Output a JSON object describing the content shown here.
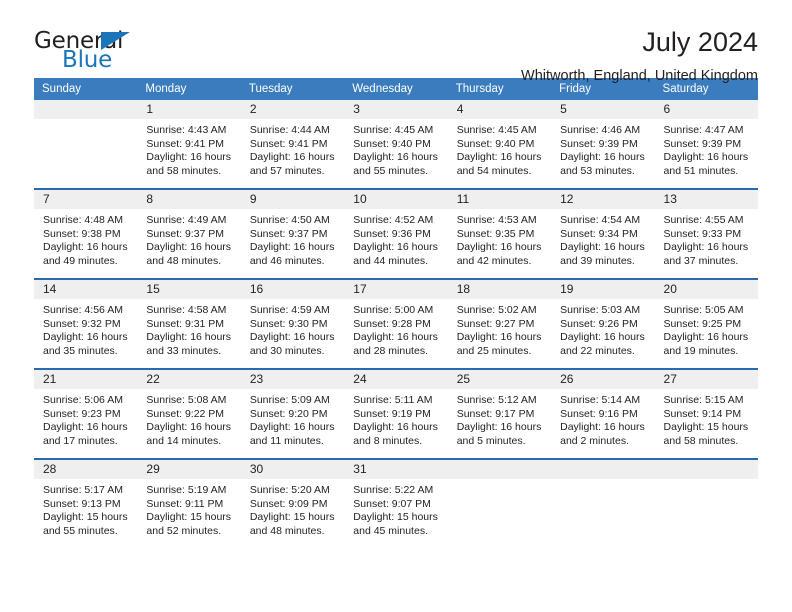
{
  "brand": {
    "name_part1": "General",
    "name_part2": "Blue",
    "accent_color": "#1b75bb"
  },
  "header": {
    "title": "July 2024",
    "subtitle": "Whitworth, England, United Kingdom"
  },
  "calendar": {
    "header_bg": "#3a7cbe",
    "daynum_bg": "#efefef",
    "separator_color": "#2a6aad",
    "weekdays": [
      "Sunday",
      "Monday",
      "Tuesday",
      "Wednesday",
      "Thursday",
      "Friday",
      "Saturday"
    ],
    "weeks": [
      [
        {
          "day": "",
          "sunrise": "",
          "sunset": "",
          "daylight_1": "",
          "daylight_2": ""
        },
        {
          "day": "1",
          "sunrise": "Sunrise: 4:43 AM",
          "sunset": "Sunset: 9:41 PM",
          "daylight_1": "Daylight: 16 hours",
          "daylight_2": "and 58 minutes."
        },
        {
          "day": "2",
          "sunrise": "Sunrise: 4:44 AM",
          "sunset": "Sunset: 9:41 PM",
          "daylight_1": "Daylight: 16 hours",
          "daylight_2": "and 57 minutes."
        },
        {
          "day": "3",
          "sunrise": "Sunrise: 4:45 AM",
          "sunset": "Sunset: 9:40 PM",
          "daylight_1": "Daylight: 16 hours",
          "daylight_2": "and 55 minutes."
        },
        {
          "day": "4",
          "sunrise": "Sunrise: 4:45 AM",
          "sunset": "Sunset: 9:40 PM",
          "daylight_1": "Daylight: 16 hours",
          "daylight_2": "and 54 minutes."
        },
        {
          "day": "5",
          "sunrise": "Sunrise: 4:46 AM",
          "sunset": "Sunset: 9:39 PM",
          "daylight_1": "Daylight: 16 hours",
          "daylight_2": "and 53 minutes."
        },
        {
          "day": "6",
          "sunrise": "Sunrise: 4:47 AM",
          "sunset": "Sunset: 9:39 PM",
          "daylight_1": "Daylight: 16 hours",
          "daylight_2": "and 51 minutes."
        }
      ],
      [
        {
          "day": "7",
          "sunrise": "Sunrise: 4:48 AM",
          "sunset": "Sunset: 9:38 PM",
          "daylight_1": "Daylight: 16 hours",
          "daylight_2": "and 49 minutes."
        },
        {
          "day": "8",
          "sunrise": "Sunrise: 4:49 AM",
          "sunset": "Sunset: 9:37 PM",
          "daylight_1": "Daylight: 16 hours",
          "daylight_2": "and 48 minutes."
        },
        {
          "day": "9",
          "sunrise": "Sunrise: 4:50 AM",
          "sunset": "Sunset: 9:37 PM",
          "daylight_1": "Daylight: 16 hours",
          "daylight_2": "and 46 minutes."
        },
        {
          "day": "10",
          "sunrise": "Sunrise: 4:52 AM",
          "sunset": "Sunset: 9:36 PM",
          "daylight_1": "Daylight: 16 hours",
          "daylight_2": "and 44 minutes."
        },
        {
          "day": "11",
          "sunrise": "Sunrise: 4:53 AM",
          "sunset": "Sunset: 9:35 PM",
          "daylight_1": "Daylight: 16 hours",
          "daylight_2": "and 42 minutes."
        },
        {
          "day": "12",
          "sunrise": "Sunrise: 4:54 AM",
          "sunset": "Sunset: 9:34 PM",
          "daylight_1": "Daylight: 16 hours",
          "daylight_2": "and 39 minutes."
        },
        {
          "day": "13",
          "sunrise": "Sunrise: 4:55 AM",
          "sunset": "Sunset: 9:33 PM",
          "daylight_1": "Daylight: 16 hours",
          "daylight_2": "and 37 minutes."
        }
      ],
      [
        {
          "day": "14",
          "sunrise": "Sunrise: 4:56 AM",
          "sunset": "Sunset: 9:32 PM",
          "daylight_1": "Daylight: 16 hours",
          "daylight_2": "and 35 minutes."
        },
        {
          "day": "15",
          "sunrise": "Sunrise: 4:58 AM",
          "sunset": "Sunset: 9:31 PM",
          "daylight_1": "Daylight: 16 hours",
          "daylight_2": "and 33 minutes."
        },
        {
          "day": "16",
          "sunrise": "Sunrise: 4:59 AM",
          "sunset": "Sunset: 9:30 PM",
          "daylight_1": "Daylight: 16 hours",
          "daylight_2": "and 30 minutes."
        },
        {
          "day": "17",
          "sunrise": "Sunrise: 5:00 AM",
          "sunset": "Sunset: 9:28 PM",
          "daylight_1": "Daylight: 16 hours",
          "daylight_2": "and 28 minutes."
        },
        {
          "day": "18",
          "sunrise": "Sunrise: 5:02 AM",
          "sunset": "Sunset: 9:27 PM",
          "daylight_1": "Daylight: 16 hours",
          "daylight_2": "and 25 minutes."
        },
        {
          "day": "19",
          "sunrise": "Sunrise: 5:03 AM",
          "sunset": "Sunset: 9:26 PM",
          "daylight_1": "Daylight: 16 hours",
          "daylight_2": "and 22 minutes."
        },
        {
          "day": "20",
          "sunrise": "Sunrise: 5:05 AM",
          "sunset": "Sunset: 9:25 PM",
          "daylight_1": "Daylight: 16 hours",
          "daylight_2": "and 19 minutes."
        }
      ],
      [
        {
          "day": "21",
          "sunrise": "Sunrise: 5:06 AM",
          "sunset": "Sunset: 9:23 PM",
          "daylight_1": "Daylight: 16 hours",
          "daylight_2": "and 17 minutes."
        },
        {
          "day": "22",
          "sunrise": "Sunrise: 5:08 AM",
          "sunset": "Sunset: 9:22 PM",
          "daylight_1": "Daylight: 16 hours",
          "daylight_2": "and 14 minutes."
        },
        {
          "day": "23",
          "sunrise": "Sunrise: 5:09 AM",
          "sunset": "Sunset: 9:20 PM",
          "daylight_1": "Daylight: 16 hours",
          "daylight_2": "and 11 minutes."
        },
        {
          "day": "24",
          "sunrise": "Sunrise: 5:11 AM",
          "sunset": "Sunset: 9:19 PM",
          "daylight_1": "Daylight: 16 hours",
          "daylight_2": "and 8 minutes."
        },
        {
          "day": "25",
          "sunrise": "Sunrise: 5:12 AM",
          "sunset": "Sunset: 9:17 PM",
          "daylight_1": "Daylight: 16 hours",
          "daylight_2": "and 5 minutes."
        },
        {
          "day": "26",
          "sunrise": "Sunrise: 5:14 AM",
          "sunset": "Sunset: 9:16 PM",
          "daylight_1": "Daylight: 16 hours",
          "daylight_2": "and 2 minutes."
        },
        {
          "day": "27",
          "sunrise": "Sunrise: 5:15 AM",
          "sunset": "Sunset: 9:14 PM",
          "daylight_1": "Daylight: 15 hours",
          "daylight_2": "and 58 minutes."
        }
      ],
      [
        {
          "day": "28",
          "sunrise": "Sunrise: 5:17 AM",
          "sunset": "Sunset: 9:13 PM",
          "daylight_1": "Daylight: 15 hours",
          "daylight_2": "and 55 minutes."
        },
        {
          "day": "29",
          "sunrise": "Sunrise: 5:19 AM",
          "sunset": "Sunset: 9:11 PM",
          "daylight_1": "Daylight: 15 hours",
          "daylight_2": "and 52 minutes."
        },
        {
          "day": "30",
          "sunrise": "Sunrise: 5:20 AM",
          "sunset": "Sunset: 9:09 PM",
          "daylight_1": "Daylight: 15 hours",
          "daylight_2": "and 48 minutes."
        },
        {
          "day": "31",
          "sunrise": "Sunrise: 5:22 AM",
          "sunset": "Sunset: 9:07 PM",
          "daylight_1": "Daylight: 15 hours",
          "daylight_2": "and 45 minutes."
        },
        {
          "day": "",
          "sunrise": "",
          "sunset": "",
          "daylight_1": "",
          "daylight_2": ""
        },
        {
          "day": "",
          "sunrise": "",
          "sunset": "",
          "daylight_1": "",
          "daylight_2": ""
        },
        {
          "day": "",
          "sunrise": "",
          "sunset": "",
          "daylight_1": "",
          "daylight_2": ""
        }
      ]
    ]
  }
}
